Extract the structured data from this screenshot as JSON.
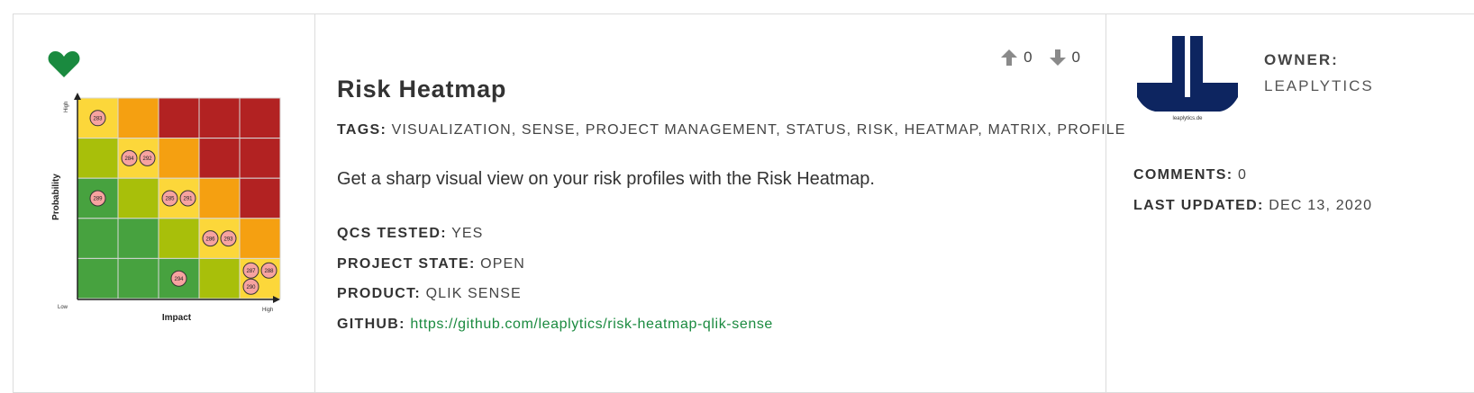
{
  "header": {
    "vote_up_count": "0",
    "vote_down_count": "0"
  },
  "listing": {
    "title": "Risk Heatmap",
    "tags_label": "TAGS:",
    "tags": "VISUALIZATION, SENSE, PROJECT MANAGEMENT, STATUS, RISK, HEATMAP, MATRIX, PROFILE",
    "description": "Get a sharp visual view on your risk profiles with the Risk Heatmap.",
    "qcs_label": "QCS TESTED:",
    "qcs_value": "YES",
    "state_label": "PROJECT STATE:",
    "state_value": "OPEN",
    "product_label": "PRODUCT:",
    "product_value": "QLIK SENSE",
    "github_label": "GITHUB:",
    "github_url": "https://github.com/leaplytics/risk-heatmap-qlik-sense"
  },
  "owner": {
    "label": "OWNER:",
    "name": "LEAPLYTICS",
    "logo_caption": "leaplytics.de",
    "brand_color": "#0d2560"
  },
  "stats": {
    "comments_label": "COMMENTS:",
    "comments_value": "0",
    "updated_label": "LAST UPDATED:",
    "updated_value": "DEC 13, 2020"
  },
  "favorite": {
    "icon": "heart-icon",
    "color": "#1a8a3f"
  },
  "thumbnail": {
    "y_axis_label": "Probability",
    "x_axis_label": "Impact",
    "y_high": "High",
    "x_low": "Low",
    "x_high": "High",
    "colors": {
      "red": "#b22222",
      "orange": "#f5a011",
      "yellow": "#fcd73a",
      "olive": "#a8bf0a",
      "green": "#47a23f"
    },
    "grid": [
      [
        "yellow",
        "orange",
        "red",
        "red",
        "red"
      ],
      [
        "olive",
        "yellow",
        "orange",
        "red",
        "red"
      ],
      [
        "green",
        "olive",
        "yellow",
        "orange",
        "red"
      ],
      [
        "green",
        "green",
        "olive",
        "yellow",
        "orange"
      ],
      [
        "green",
        "green",
        "green",
        "olive",
        "yellow"
      ]
    ],
    "markers": [
      {
        "label": "283",
        "row": 0,
        "col": 0,
        "slot": 0
      },
      {
        "label": "284",
        "row": 1,
        "col": 1,
        "slot": 0
      },
      {
        "label": "292",
        "row": 1,
        "col": 1,
        "slot": 1
      },
      {
        "label": "289",
        "row": 2,
        "col": 0,
        "slot": 0
      },
      {
        "label": "285",
        "row": 2,
        "col": 2,
        "slot": 0
      },
      {
        "label": "291",
        "row": 2,
        "col": 2,
        "slot": 1
      },
      {
        "label": "286",
        "row": 3,
        "col": 3,
        "slot": 0
      },
      {
        "label": "293",
        "row": 3,
        "col": 3,
        "slot": 1
      },
      {
        "label": "294",
        "row": 4,
        "col": 2,
        "slot": 0
      },
      {
        "label": "287",
        "row": 4,
        "col": 4,
        "slot": 0
      },
      {
        "label": "288",
        "row": 4,
        "col": 4,
        "slot": 1
      },
      {
        "label": "290",
        "row": 4,
        "col": 4,
        "slot": 2
      }
    ]
  }
}
